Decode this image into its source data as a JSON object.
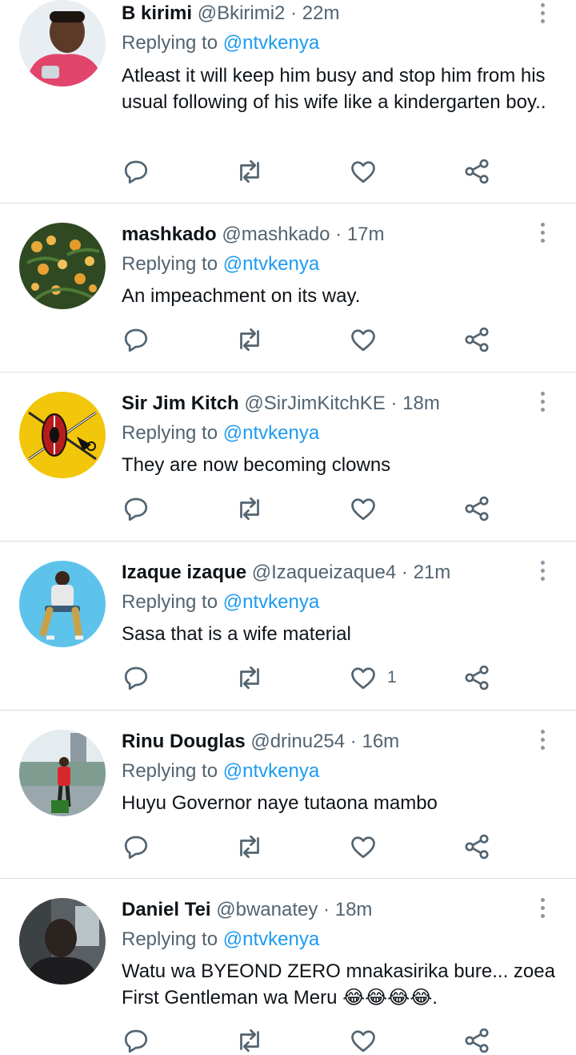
{
  "replying_label": "Replying to",
  "tweets": [
    {
      "name": "B kirimi",
      "handle": "@Bkirimi2",
      "dot": "·",
      "time": "22m",
      "mention": "@ntvkenya",
      "text": "Atleast it will keep him busy and stop him from his usual following of his wife like a kindergarten boy..",
      "likes": ""
    },
    {
      "name": "mashkado",
      "handle": "@mashkado",
      "dot": "·",
      "time": "17m",
      "mention": "@ntvkenya",
      "text": "An impeachment on its way.",
      "likes": ""
    },
    {
      "name": "Sir Jim Kitch",
      "handle": "@SirJimKitchKE",
      "dot": "·",
      "time": "18m",
      "mention": "@ntvkenya",
      "text": "They are now becoming clowns",
      "likes": ""
    },
    {
      "name": "Izaque izaque",
      "handle": "@Izaqueizaque4",
      "dot": "·",
      "time": "21m",
      "mention": "@ntvkenya",
      "text": "Sasa that is a wife material",
      "likes": "1"
    },
    {
      "name": "Rinu Douglas",
      "handle": "@drinu254",
      "dot": "·",
      "time": "16m",
      "mention": "@ntvkenya",
      "text": "Huyu Governor naye tutaona mambo",
      "likes": ""
    },
    {
      "name": "Daniel Tei",
      "handle": "@bwanatey",
      "dot": "·",
      "time": "18m",
      "mention": "@ntvkenya",
      "text": "Watu wa BYEOND ZERO mnakasirika bure... zoea First Gentleman wa Meru 😂😂😂😂.",
      "likes": ""
    }
  ],
  "icons": {
    "reply": "reply-icon",
    "retweet": "retweet-icon",
    "like": "heart-icon",
    "share": "share-icon",
    "more": "more-icon"
  },
  "colors": {
    "text": "#0f1419",
    "secondary": "#536471",
    "link": "#1d9bf0",
    "divider": "#d9dee2"
  }
}
